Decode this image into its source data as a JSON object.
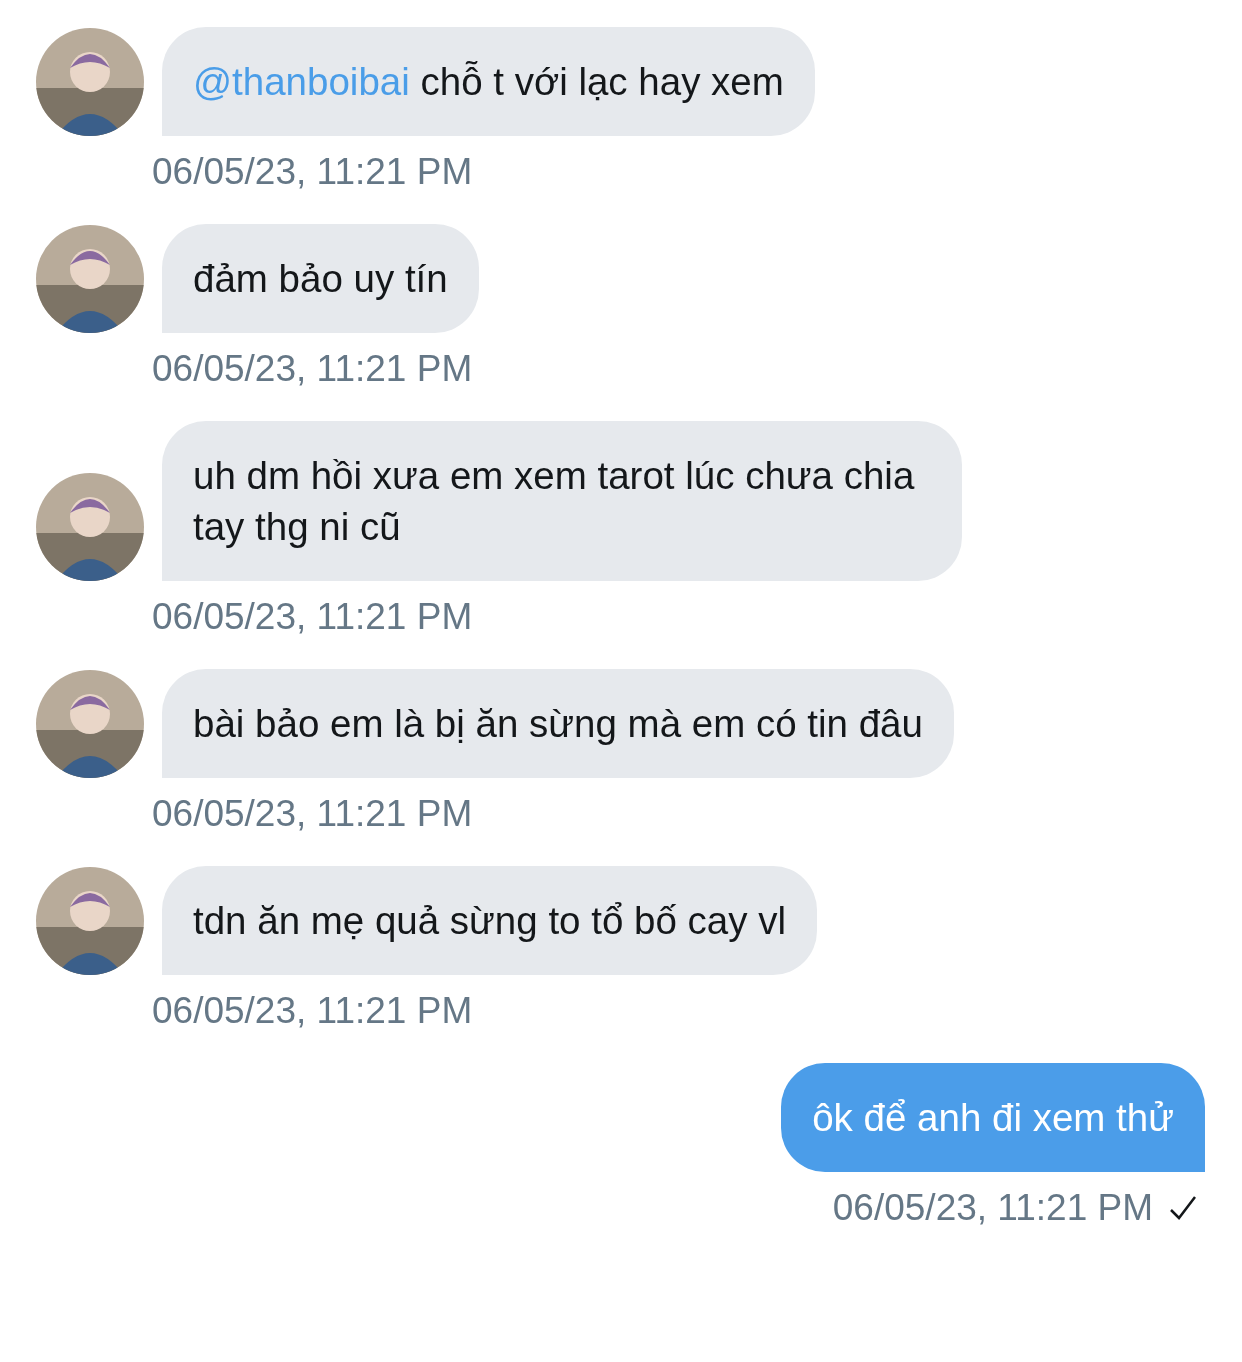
{
  "messages": [
    {
      "kind": "incoming",
      "mention": "@thanboibai",
      "text": "chỗ t với lạc hay xem",
      "time": "06/05/23, 11:21 PM"
    },
    {
      "kind": "incoming",
      "text": "đảm bảo uy tín",
      "time": "06/05/23, 11:21 PM"
    },
    {
      "kind": "incoming",
      "text": "uh dm hồi xưa em xem tarot lúc chưa chia tay thg ni cũ",
      "time": "06/05/23, 11:21 PM"
    },
    {
      "kind": "incoming",
      "text": "bài bảo em là bị ăn sừng mà em có tin đâu",
      "time": "06/05/23, 11:21 PM"
    },
    {
      "kind": "incoming",
      "text": "tdn ăn mẹ quả sừng to tổ bố cay vl",
      "time": "06/05/23, 11:21 PM"
    },
    {
      "kind": "outgoing",
      "text": "ôk để anh đi xem thử",
      "time": "06/05/23, 11:21 PM",
      "sent": true
    }
  ]
}
